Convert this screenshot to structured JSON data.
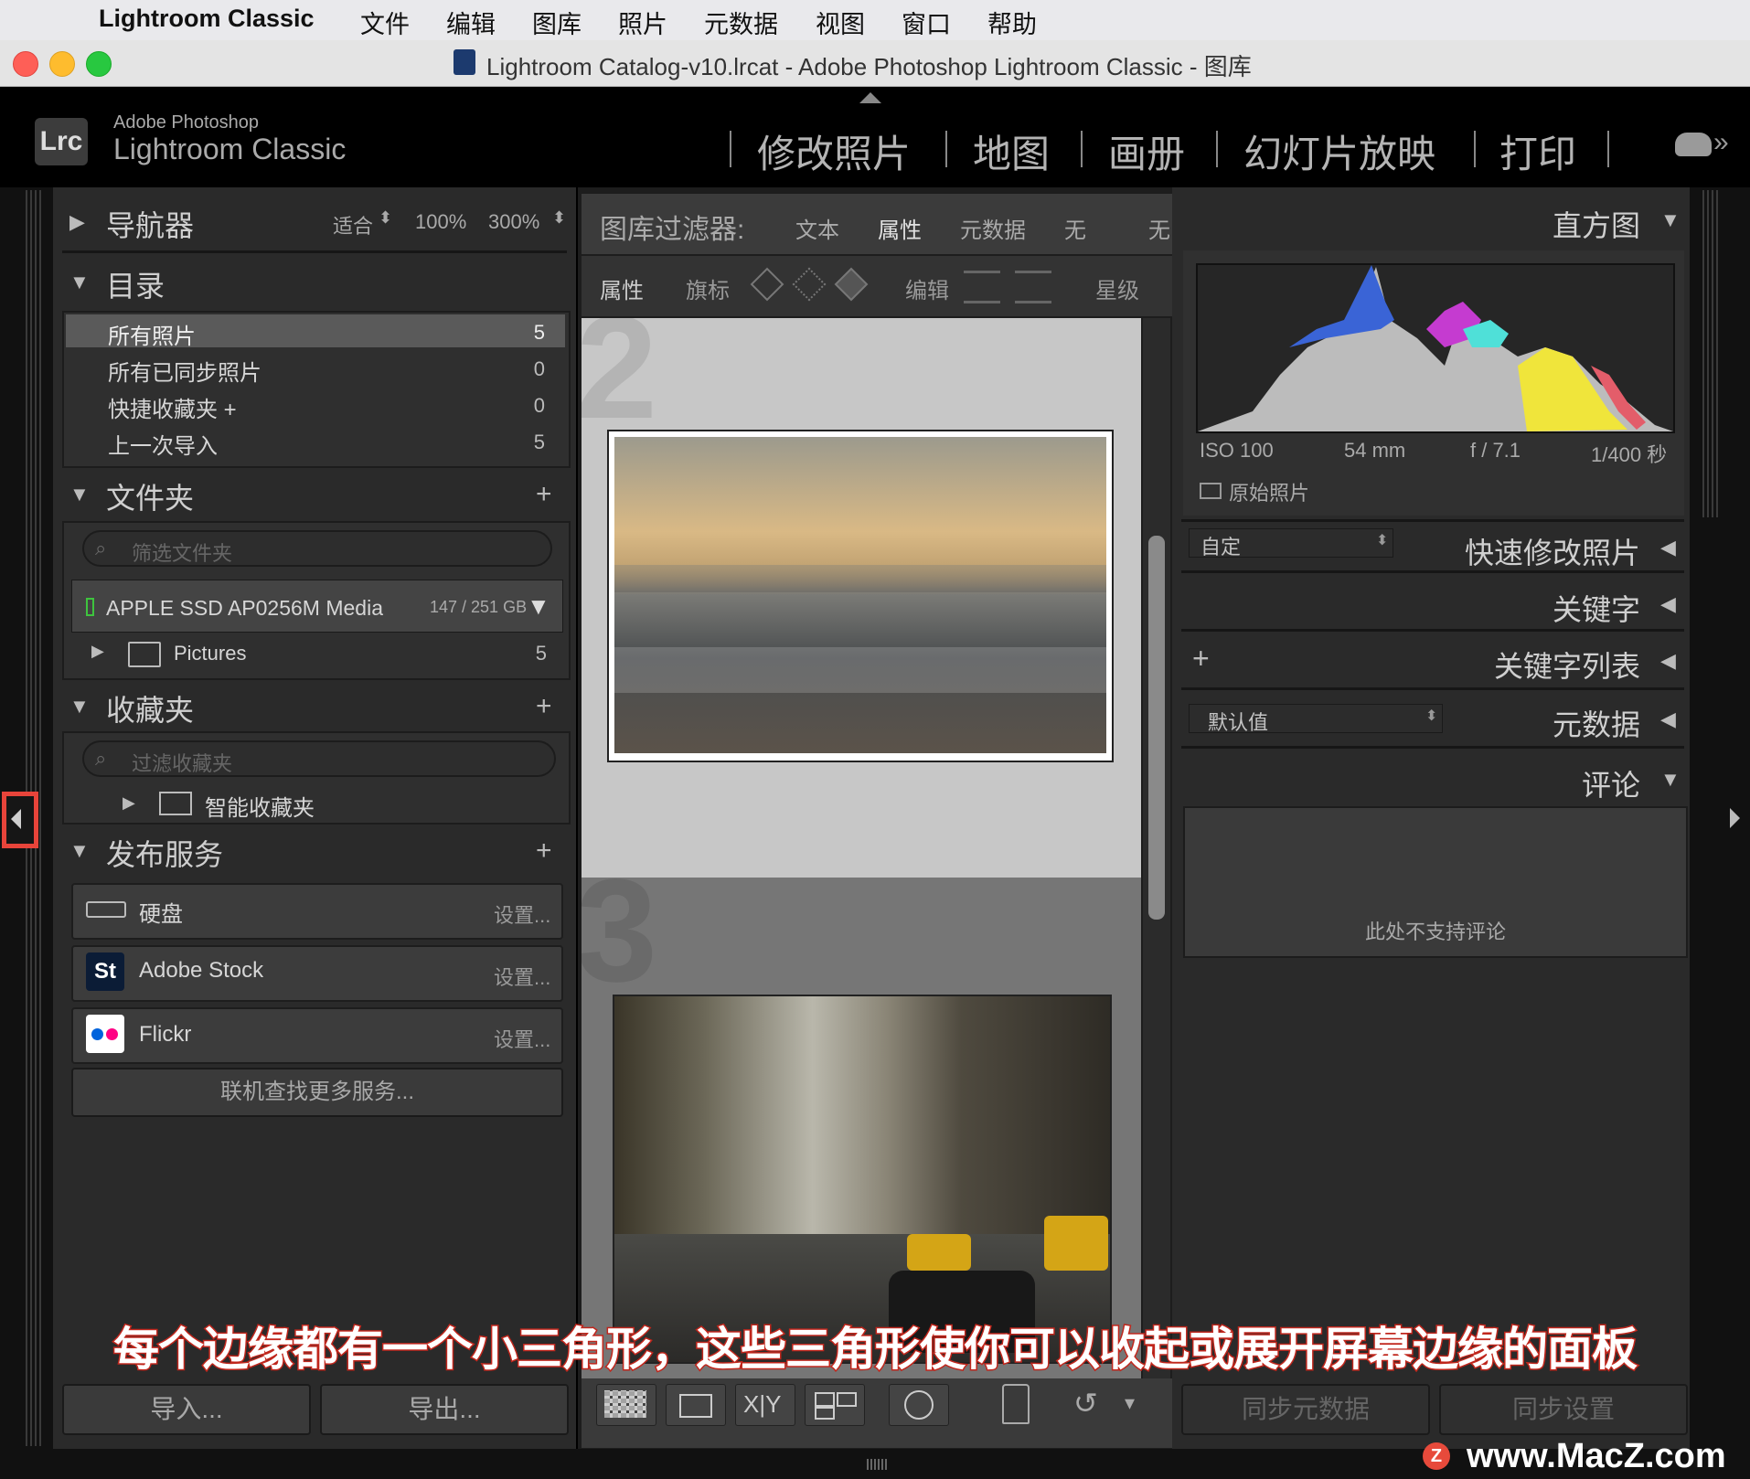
{
  "menubar": {
    "app_name": "Lightroom Classic",
    "items": [
      "文件",
      "编辑",
      "图库",
      "照片",
      "元数据",
      "视图",
      "窗口",
      "帮助"
    ]
  },
  "titlebar": {
    "title": "Lightroom Catalog-v10.lrcat - Adobe Photoshop Lightroom Classic - 图库"
  },
  "identity": {
    "logo": "Lrc",
    "brand_small": "Adobe Photoshop",
    "brand_large": "Lightroom Classic",
    "modules": [
      "修改照片",
      "地图",
      "画册",
      "幻灯片放映",
      "打印"
    ]
  },
  "left": {
    "navigator": {
      "title": "导航器",
      "zoom_fit": "适合",
      "zoom_100": "100%",
      "zoom_300": "300%"
    },
    "catalog": {
      "title": "目录",
      "items": [
        {
          "label": "所有照片",
          "count": "5"
        },
        {
          "label": "所有已同步照片",
          "count": "0"
        },
        {
          "label": "快捷收藏夹 +",
          "count": "0"
        },
        {
          "label": "上一次导入",
          "count": "5"
        }
      ]
    },
    "folders": {
      "title": "文件夹",
      "filter_placeholder": "筛选文件夹",
      "volume_name": "APPLE SSD AP0256M Media",
      "volume_size": "147 / 251 GB",
      "folder_name": "Pictures",
      "folder_count": "5"
    },
    "collections": {
      "title": "收藏夹",
      "filter_placeholder": "过滤收藏夹",
      "smart": "智能收藏夹"
    },
    "publish": {
      "title": "发布服务",
      "services": [
        {
          "name": "硬盘",
          "setup": "设置..."
        },
        {
          "name": "Adobe Stock",
          "setup": "设置..."
        },
        {
          "name": "Flickr",
          "setup": "设置..."
        }
      ],
      "find_more": "联机查找更多服务..."
    },
    "import_label": "导入...",
    "export_label": "导出..."
  },
  "center": {
    "filter_bar": {
      "label": "图库过滤器:",
      "tabs": [
        "文本",
        "属性",
        "元数据",
        "无"
      ],
      "overflow": "无"
    },
    "attr_bar": {
      "label": "属性",
      "flag": "旗标",
      "edit": "编辑",
      "rating": "星级"
    },
    "cell_numbers": [
      "2",
      "3"
    ]
  },
  "right": {
    "histogram": {
      "title": "直方图",
      "iso": "ISO 100",
      "focal": "54 mm",
      "aperture": "f / 7.1",
      "shutter": "1/400 秒",
      "original": "原始照片"
    },
    "quick_develop": {
      "title": "快速修改照片",
      "preset": "自定"
    },
    "keywording": {
      "title": "关键字"
    },
    "keyword_list": {
      "title": "关键字列表",
      "add": "+"
    },
    "metadata": {
      "title": "元数据",
      "preset": "默认值"
    },
    "comments": {
      "title": "评论",
      "empty": "此处不支持评论"
    },
    "sync_metadata": "同步元数据",
    "sync_settings": "同步设置"
  },
  "caption": "每个边缘都有一个小三角形，这些三角形使你可以收起或展开屏幕边缘的面板",
  "watermark": "www.MacZ.com",
  "colors": {
    "highlight_box": "#e8443a",
    "panel_bg": "#2a2a2a",
    "caption_fill": "#ffffff",
    "caption_stroke": "#c0261c"
  }
}
